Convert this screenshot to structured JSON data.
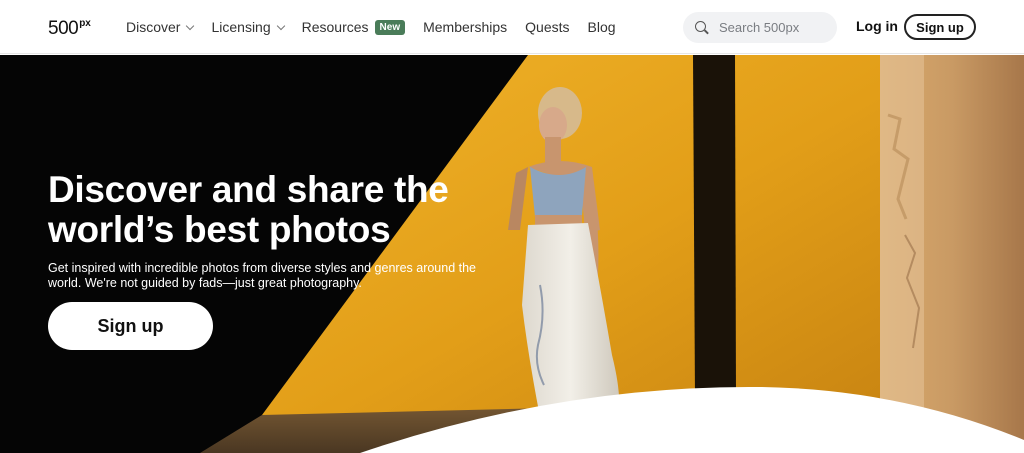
{
  "brand": {
    "logo_main": "500",
    "logo_sup": "px"
  },
  "nav": {
    "items": [
      {
        "label": "Discover",
        "dropdown": true
      },
      {
        "label": "Licensing",
        "dropdown": true
      },
      {
        "label": "Resources",
        "badge": "New"
      },
      {
        "label": "Memberships"
      },
      {
        "label": "Quests"
      },
      {
        "label": "Blog"
      }
    ],
    "search_placeholder": "Search 500px",
    "login": "Log in",
    "signup": "Sign up"
  },
  "hero": {
    "title": "Discover and share the world’s best photos",
    "subtitle": "Get inspired with incredible photos from diverse styles and genres around the world. We're not guided by fads—just great photography.",
    "cta": "Sign up"
  },
  "colors": {
    "badge_green": "#4a7c59",
    "wall_yellow": "#e3a21a",
    "shadow_black": "#050505"
  }
}
